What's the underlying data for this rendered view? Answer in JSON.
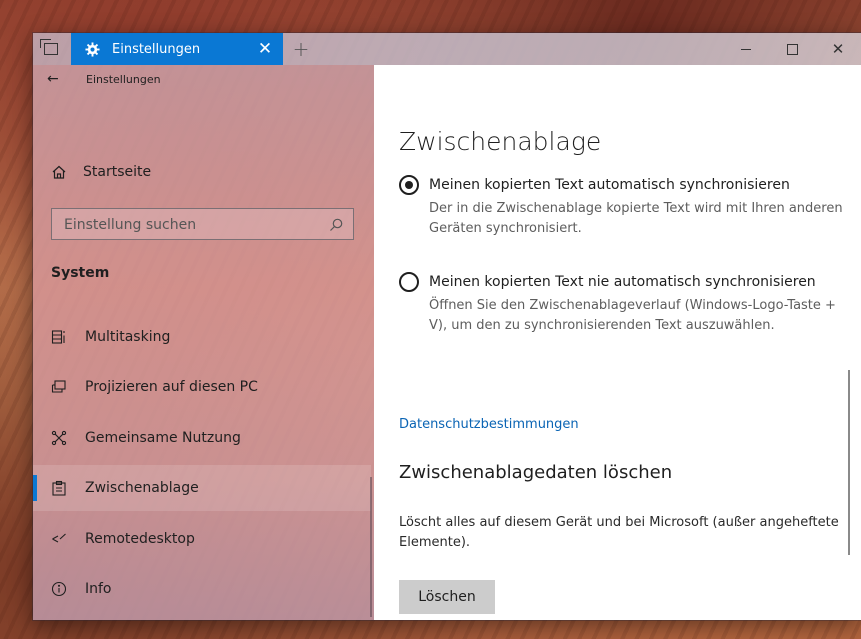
{
  "titlebar": {
    "tab_title": "Einstellungen",
    "icons": [
      "task-view-icon",
      "gear-icon",
      "close-icon",
      "plus-icon",
      "minimize-icon",
      "maximize-icon",
      "close-icon"
    ]
  },
  "sidebar": {
    "back_title": "Einstellungen",
    "home_label": "Startseite",
    "search_placeholder": "Einstellung suchen",
    "section_header": "System",
    "items": [
      {
        "label": "Multitasking",
        "icon": "multitasking-icon"
      },
      {
        "label": "Projizieren auf diesen PC",
        "icon": "project-icon"
      },
      {
        "label": "Gemeinsame Nutzung",
        "icon": "share-icon"
      },
      {
        "label": "Zwischenablage",
        "icon": "clipboard-icon",
        "selected": true
      },
      {
        "label": "Remotedesktop",
        "icon": "remote-desktop-icon"
      },
      {
        "label": "Info",
        "icon": "info-icon"
      }
    ]
  },
  "main": {
    "title": "Zwischenablage",
    "options": [
      {
        "label": "Meinen kopierten Text automatisch synchronisieren",
        "description": "Der in die Zwischenablage kopierte Text wird mit Ihren anderen Geräten synchronisiert.",
        "checked": true
      },
      {
        "label": "Meinen kopierten Text nie automatisch synchronisieren",
        "description": "Öffnen Sie den Zwischenablageverlauf (Windows-Logo-Taste + V), um den zu synchronisierenden Text auszuwählen.",
        "checked": false
      }
    ],
    "privacy_link": "Datenschutzbestimmungen",
    "clear_heading": "Zwischenablagedaten löschen",
    "clear_description": "Löscht alles auf diesem Gerät und bei Microsoft (außer angeheftete Elemente).",
    "clear_button": "Löschen"
  },
  "colors": {
    "accent": "#0a78d4",
    "link": "#0a64b4",
    "button_bg": "#cccccc"
  }
}
